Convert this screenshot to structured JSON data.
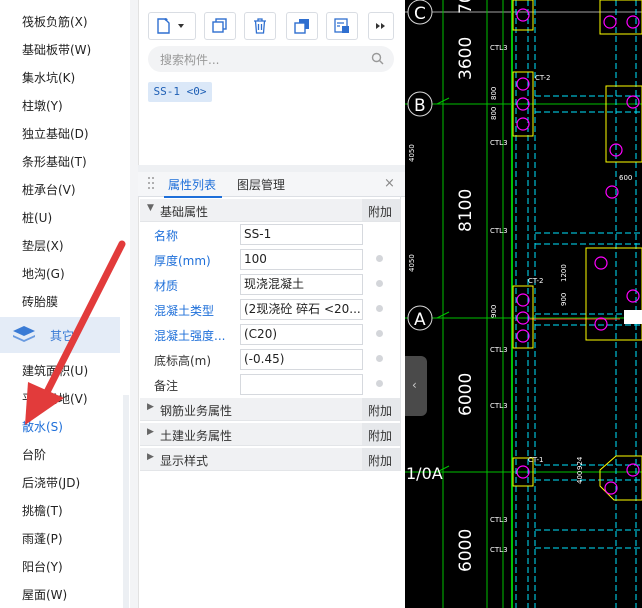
{
  "nav": {
    "items_top": [
      "筏板负筋(X)",
      "基础板带(W)",
      "集水坑(K)",
      "柱墩(Y)",
      "独立基础(D)",
      "条形基础(T)",
      "桩承台(V)",
      "桩(U)",
      "垫层(X)",
      "地沟(G)",
      "砖胎膜"
    ],
    "group_label": "其它",
    "items_bottom": [
      "建筑面积(U)",
      "平整场地(V)",
      "散水(S)",
      "台阶",
      "后浇带(JD)",
      "挑檐(T)",
      "雨蓬(P)",
      "阳台(Y)",
      "屋面(W)"
    ]
  },
  "components": {
    "toolbar_icons": [
      "new-dropdown-icon",
      "copy-icon",
      "delete-icon",
      "duplicate-icon",
      "layer-icon",
      "more-icon"
    ],
    "search_placeholder": "搜索构件...",
    "selected_tag": "SS-1 <0>"
  },
  "props": {
    "tab_active": "属性列表",
    "tab_other": "图层管理",
    "close": "×",
    "sections": [
      "基础属性",
      "钢筋业务属性",
      "土建业务属性",
      "显示样式"
    ],
    "add_label": "附加",
    "rows": [
      {
        "label": "名称",
        "value": "SS-1",
        "blue": true
      },
      {
        "label": "厚度(mm)",
        "value": "100",
        "blue": true
      },
      {
        "label": "材质",
        "value": "现浇混凝土",
        "blue": true
      },
      {
        "label": "混凝土类型",
        "value": "(2现浇砼 碎石 <20...",
        "blue": true
      },
      {
        "label": "混凝土强度...",
        "value": "(C20)",
        "blue": true
      },
      {
        "label": "底标高(m)",
        "value": "(-0.45)",
        "blue": false
      },
      {
        "label": "备注",
        "value": "",
        "blue": false
      }
    ]
  },
  "cad": {
    "axis_labels": [
      "C",
      "B",
      "A",
      "1/0A"
    ],
    "dims": [
      "3600",
      "8100",
      "6000",
      "6000",
      "70"
    ],
    "tags": [
      "CT-2",
      "CT-2",
      "CT-1"
    ],
    "small_dims": [
      "800",
      "800",
      "4050",
      "4050",
      "900",
      "900",
      "1200",
      "600",
      "924",
      "400"
    ],
    "line_labels": [
      "CTL3",
      "CTL3",
      "CTL3",
      "CTL3",
      "CTL3",
      "CTL3",
      "CTL3"
    ]
  },
  "colors": {
    "accent": "#1e6fd9",
    "cad_bg": "#000000",
    "cad_green": "#00c000",
    "cad_yellow": "#ffff00",
    "cad_cyan": "#00e5ff",
    "cad_magenta": "#ff00ff"
  }
}
